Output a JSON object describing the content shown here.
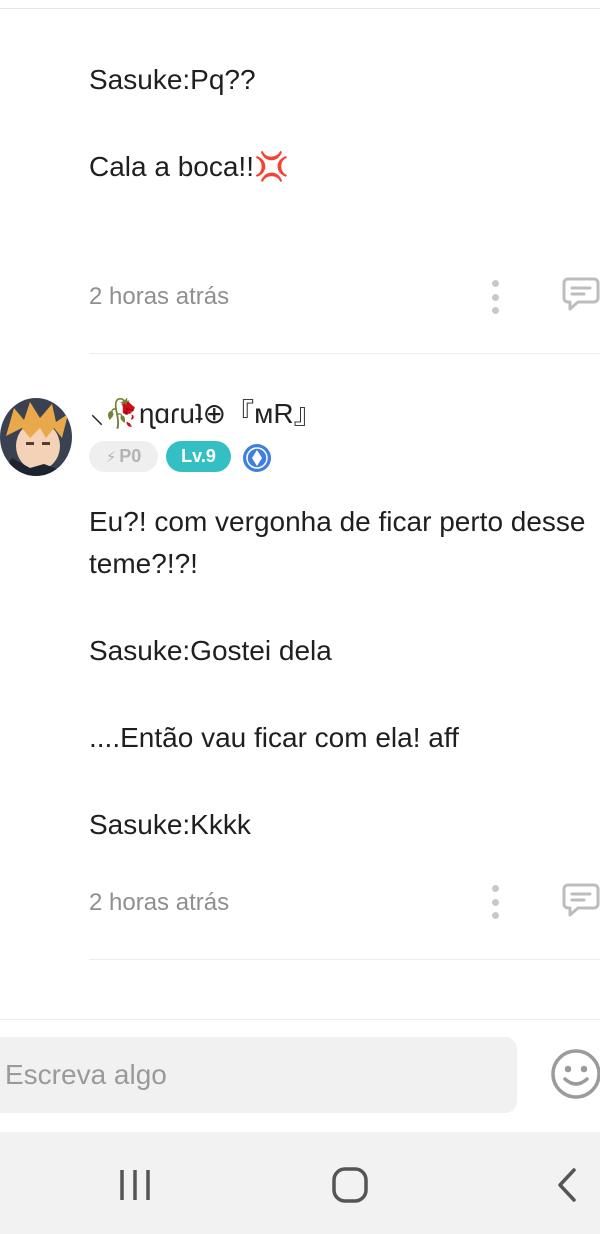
{
  "comments": [
    {
      "lines": [
        "Sasuke:Pq??",
        "Cala a boca!!💢"
      ],
      "time": "2 horas atrás"
    },
    {
      "author": {
        "name": "⸜🥀ɳɑɾuʇ⊕『ᴍR』",
        "points_badge": "P0",
        "level_badge": "Lv.9"
      },
      "lines": [
        "Eu?! com vergonha de ficar perto desse",
        "teme?!?!",
        "Sasuke:Gostei dela",
        "....Então vau ficar com ela! aff",
        "Sasuke:Kkkk"
      ],
      "time": "2 horas atrás"
    }
  ],
  "composer": {
    "placeholder": "Escreva algo"
  },
  "colors": {
    "level_badge": "#33bfc4",
    "timestamp": "#8f8f8f",
    "icons": "#bdbdbd"
  },
  "icons": [
    "more-vertical-icon",
    "reply-bubble-icon",
    "shield-badge-icon",
    "smiley-icon",
    "recents-icon",
    "home-icon",
    "back-icon"
  ]
}
